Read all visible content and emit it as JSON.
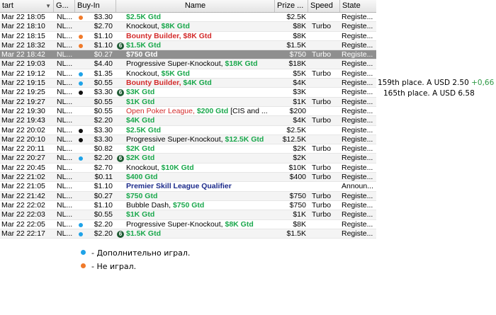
{
  "columns": [
    "tart",
    "G...",
    "Buy-In",
    "Name",
    "Prize ...",
    "Speed",
    "State"
  ],
  "rows": [
    {
      "start": "Mar 22  18:05",
      "game": "NL...",
      "dot": "orange",
      "buyin": "$3.30",
      "badge": "",
      "pre": "",
      "hi": "$2.5K Gtd",
      "hi_style": "grn",
      "post": "",
      "prize": "$2.5K",
      "speed": "",
      "state": "Registe..."
    },
    {
      "start": "Mar 22  18:10",
      "game": "NL...",
      "dot": "",
      "buyin": "$2.70",
      "badge": "",
      "pre": "Knockout, ",
      "hi": "$8K Gtd",
      "hi_style": "grn",
      "post": "",
      "prize": "$8K",
      "speed": "Turbo",
      "state": "Registe..."
    },
    {
      "start": "Mar 22  18:15",
      "game": "NL...",
      "dot": "orange",
      "buyin": "$1.10",
      "badge": "",
      "pre": "",
      "hi": "Bounty Builder, ",
      "hi_style": "red",
      "post": "",
      "hi2": "$8K Gtd",
      "hi2_style": "red",
      "prize": "$8K",
      "speed": "",
      "state": "Registe..."
    },
    {
      "start": "Mar 22  18:32",
      "game": "NL...",
      "dot": "orange",
      "buyin": "$1.10",
      "badge": "6",
      "pre": "",
      "hi": "$1.5K Gtd",
      "hi_style": "grn",
      "post": "",
      "prize": "$1.5K",
      "speed": "",
      "state": "Registe..."
    },
    {
      "start": "Mar 22  18:42",
      "game": "NL...",
      "dot": "",
      "buyin": "$0.27",
      "badge": "",
      "pre": "",
      "hi": "$750 Gtd",
      "hi_style": "white-b",
      "post": "",
      "prize": "$750",
      "speed": "Turbo",
      "state": "Registe...",
      "selected": true
    },
    {
      "start": "Mar 22  19:03",
      "game": "NL...",
      "dot": "",
      "buyin": "$4.40",
      "badge": "",
      "pre": "Progressive Super-Knockout, ",
      "hi": "$18K Gtd",
      "hi_style": "grn",
      "post": "",
      "prize": "$18K",
      "speed": "",
      "state": "Registe..."
    },
    {
      "start": "Mar 22  19:12",
      "game": "NL...",
      "dot": "blue",
      "buyin": "$1.35",
      "badge": "",
      "pre": "Knockout, ",
      "hi": "$5K Gtd",
      "hi_style": "grn",
      "post": "",
      "prize": "$5K",
      "speed": "Turbo",
      "state": "Registe..."
    },
    {
      "start": "Mar 22  19:15",
      "game": "NL...",
      "dot": "blue",
      "buyin": "$0.55",
      "badge": "",
      "pre": "",
      "hi": "Bounty Builder, ",
      "hi_style": "red",
      "post": "",
      "hi2": "$4K Gtd",
      "hi2_style": "grn",
      "prize": "$4K",
      "speed": "",
      "state": "Registe..."
    },
    {
      "start": "Mar 22  19:25",
      "game": "NL...",
      "dot": "black",
      "buyin": "$3.30",
      "badge": "6",
      "pre": "",
      "hi": "$3K Gtd",
      "hi_style": "grn",
      "post": "",
      "prize": "$3K",
      "speed": "",
      "state": "Registe..."
    },
    {
      "start": "Mar 22  19:27",
      "game": "NL...",
      "dot": "",
      "buyin": "$0.55",
      "badge": "",
      "pre": "",
      "hi": "$1K Gtd",
      "hi_style": "grn",
      "post": "",
      "prize": "$1K",
      "speed": "Turbo",
      "state": "Registe..."
    },
    {
      "start": "Mar 22  19:30",
      "game": "NL...",
      "dot": "",
      "buyin": "$0.55",
      "badge": "",
      "pre": "",
      "hi": "Open Poker League, ",
      "hi_style": "red-plain",
      "post": "",
      "hi2": "$200 Gtd",
      "hi2_style": "grn",
      "post2": " [CIS and ...",
      "prize": "$200",
      "speed": "",
      "state": "Registe..."
    },
    {
      "start": "Mar 22  19:43",
      "game": "NL...",
      "dot": "",
      "buyin": "$2.20",
      "badge": "",
      "pre": "",
      "hi": "$4K Gtd",
      "hi_style": "grn",
      "post": "",
      "prize": "$4K",
      "speed": "Turbo",
      "state": "Registe..."
    },
    {
      "start": "Mar 22  20:02",
      "game": "NL...",
      "dot": "black",
      "buyin": "$3.30",
      "badge": "",
      "pre": "",
      "hi": "$2.5K Gtd",
      "hi_style": "grn",
      "post": "",
      "prize": "$2.5K",
      "speed": "",
      "state": "Registe..."
    },
    {
      "start": "Mar 22  20:10",
      "game": "NL...",
      "dot": "black",
      "buyin": "$3.30",
      "badge": "",
      "pre": "Progressive Super-Knockout, ",
      "hi": "$12.5K Gtd",
      "hi_style": "grn",
      "post": "",
      "prize": "$12.5K",
      "speed": "",
      "state": "Registe..."
    },
    {
      "start": "Mar 22  20:11",
      "game": "NL...",
      "dot": "",
      "buyin": "$0.82",
      "badge": "",
      "pre": "",
      "hi": "$2K Gtd",
      "hi_style": "grn",
      "post": "",
      "prize": "$2K",
      "speed": "Turbo",
      "state": "Registe..."
    },
    {
      "start": "Mar 22  20:27",
      "game": "NL...",
      "dot": "blue",
      "buyin": "$2.20",
      "badge": "6",
      "pre": "",
      "hi": "$2K Gtd",
      "hi_style": "grn",
      "post": "",
      "prize": "$2K",
      "speed": "",
      "state": "Registe..."
    },
    {
      "start": "Mar 22  20:45",
      "game": "NL...",
      "dot": "",
      "buyin": "$2.70",
      "badge": "",
      "pre": "Knockout, ",
      "hi": "$10K Gtd",
      "hi_style": "grn",
      "post": "",
      "prize": "$10K",
      "speed": "Turbo",
      "state": "Registe..."
    },
    {
      "start": "Mar 22  21:02",
      "game": "NL...",
      "dot": "",
      "buyin": "$0.11",
      "badge": "",
      "pre": "",
      "hi": "$400 Gtd",
      "hi_style": "grn",
      "post": "",
      "prize": "$400",
      "speed": "Turbo",
      "state": "Registe..."
    },
    {
      "start": "Mar 22  21:05",
      "game": "NL...",
      "dot": "",
      "buyin": "$1.10",
      "badge": "",
      "pre": "",
      "hi": "Premier Skill League Qualifier",
      "hi_style": "navy",
      "post": "",
      "prize": "",
      "speed": "",
      "state": "Announ..."
    },
    {
      "start": "Mar 22  21:42",
      "game": "NL...",
      "dot": "",
      "buyin": "$0.27",
      "badge": "",
      "pre": "",
      "hi": "$750 Gtd",
      "hi_style": "grn",
      "post": "",
      "prize": "$750",
      "speed": "Turbo",
      "state": "Registe..."
    },
    {
      "start": "Mar 22  22:02",
      "game": "NL...",
      "dot": "",
      "buyin": "$1.10",
      "badge": "",
      "pre": "Bubble Dash, ",
      "hi": "$750 Gtd",
      "hi_style": "grn",
      "post": "",
      "prize": "$750",
      "speed": "Turbo",
      "state": "Registe..."
    },
    {
      "start": "Mar 22  22:03",
      "game": "NL...",
      "dot": "",
      "buyin": "$0.55",
      "badge": "",
      "pre": "",
      "hi": "$1K Gtd",
      "hi_style": "grn",
      "post": "",
      "prize": "$1K",
      "speed": "Turbo",
      "state": "Registe..."
    },
    {
      "start": "Mar 22  22:05",
      "game": "NL...",
      "dot": "blue",
      "buyin": "$2.20",
      "badge": "",
      "pre": "Progressive Super-Knockout, ",
      "hi": "$8K Gtd",
      "hi_style": "grn",
      "post": "",
      "prize": "$8K",
      "speed": "",
      "state": "Registe..."
    },
    {
      "start": "Mar 22  22:17",
      "game": "NL...",
      "dot": "blue",
      "buyin": "$2.20",
      "badge": "6",
      "pre": "",
      "hi": "$1.5K Gtd",
      "hi_style": "grn",
      "post": "",
      "prize": "$1.5K",
      "speed": "",
      "state": "Registe..."
    }
  ],
  "notes": [
    {
      "text": "159th place. A USD 2.50",
      "gain": "+0,66"
    },
    {
      "text": "165th place. A USD 6.58",
      "gain": ""
    }
  ],
  "legend": [
    {
      "color": "#1fa3e8",
      "text": "- Дополнительно играл."
    },
    {
      "color": "#f07a2a",
      "text": "- Не играл."
    }
  ]
}
